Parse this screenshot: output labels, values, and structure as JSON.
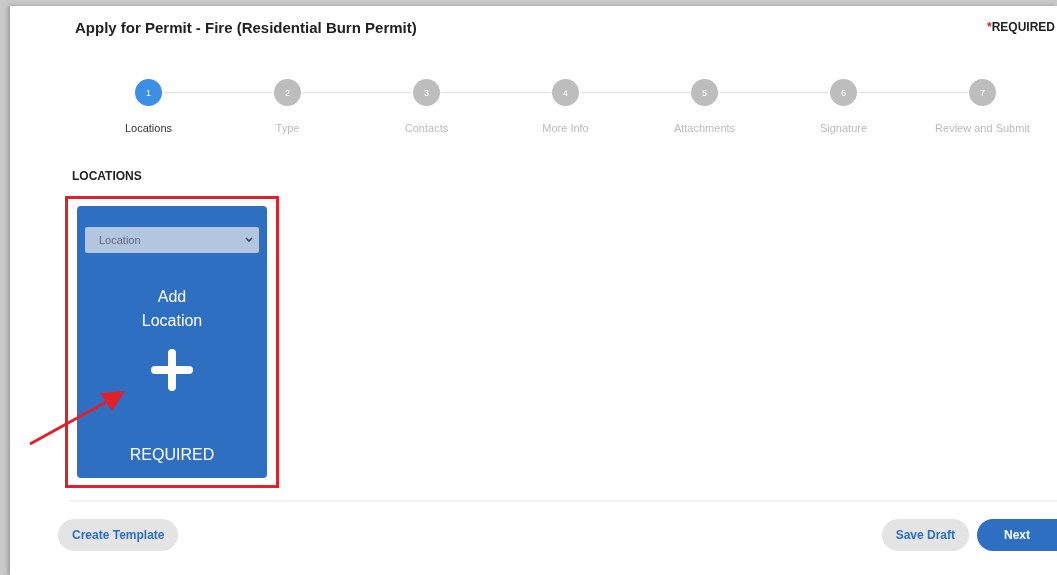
{
  "page": {
    "title": "Apply for Permit - Fire (Residential Burn Permit)",
    "required_mark": "*",
    "required_label": "REQUIRED"
  },
  "steps": [
    {
      "number": "1",
      "label": "Locations",
      "selected": true
    },
    {
      "number": "2",
      "label": "Type",
      "selected": false
    },
    {
      "number": "3",
      "label": "Contacts",
      "selected": false
    },
    {
      "number": "4",
      "label": "More Info",
      "selected": false
    },
    {
      "number": "5",
      "label": "Attachments",
      "selected": false
    },
    {
      "number": "6",
      "label": "Signature",
      "selected": false
    },
    {
      "number": "7",
      "label": "Review and Submit",
      "selected": false
    }
  ],
  "section": {
    "heading": "LOCATIONS"
  },
  "location_card": {
    "dropdown": {
      "value": "Location"
    },
    "title": "Add Location",
    "status": "REQUIRED"
  },
  "footer": {
    "buttons": [
      {
        "label": "Create Template",
        "kind": "secondary"
      },
      {
        "label": "Save Draft",
        "kind": "secondary"
      },
      {
        "label": "Next",
        "kind": "primary"
      }
    ]
  }
}
